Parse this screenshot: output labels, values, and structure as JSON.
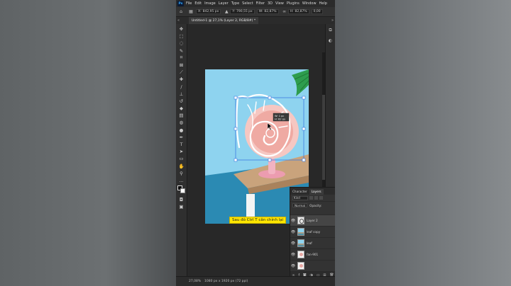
{
  "app": {
    "logo_text": "Ps",
    "menu": [
      "File",
      "Edit",
      "Image",
      "Layer",
      "Type",
      "Select",
      "Filter",
      "3D",
      "View",
      "Plugins",
      "Window",
      "Help"
    ]
  },
  "options_bar": {
    "x_label": "X:",
    "x_value": "842,95 px",
    "y_label": "Y:",
    "y_value": "790,55 px",
    "w_label": "W:",
    "w_value": "82,87%",
    "h_label": "H:",
    "h_value": "82,87%",
    "angle_value": "0,00"
  },
  "document": {
    "tab_title": "Untitled-1 @ 27,1% (Layer 2, RGB/8#) *"
  },
  "transform_tooltip": {
    "line1": "W: 1 pc",
    "line2": "H: 82 px"
  },
  "caption": "Sau đó Ctrl T cân chỉnh lại",
  "layers_panel": {
    "tabs": [
      "Character",
      "Layers"
    ],
    "active_tab": "Layers",
    "search_placeholder": "Kind",
    "blend_mode": "Normal",
    "opacity_label": "Opacity:",
    "layers": [
      {
        "name": "Layer 2",
        "selected": true,
        "thumb": "stroke"
      },
      {
        "name": "leaf copy",
        "selected": false,
        "thumb": "photo"
      },
      {
        "name": "leaf",
        "selected": false,
        "thumb": "photo"
      },
      {
        "name": "fan-901",
        "selected": false,
        "thumb": "fan"
      },
      {
        "name": "",
        "selected": false,
        "thumb": "fan"
      }
    ]
  },
  "status": {
    "zoom": "27,08%",
    "doc_size": "1080 px x 1920 px (72 ppi)"
  },
  "colors": {
    "sky": "#8ed3ef",
    "wall": "#2b8ab3",
    "table": "#c9a37c",
    "fan": "#e8a7a2",
    "caption_bg": "#ffe600"
  }
}
